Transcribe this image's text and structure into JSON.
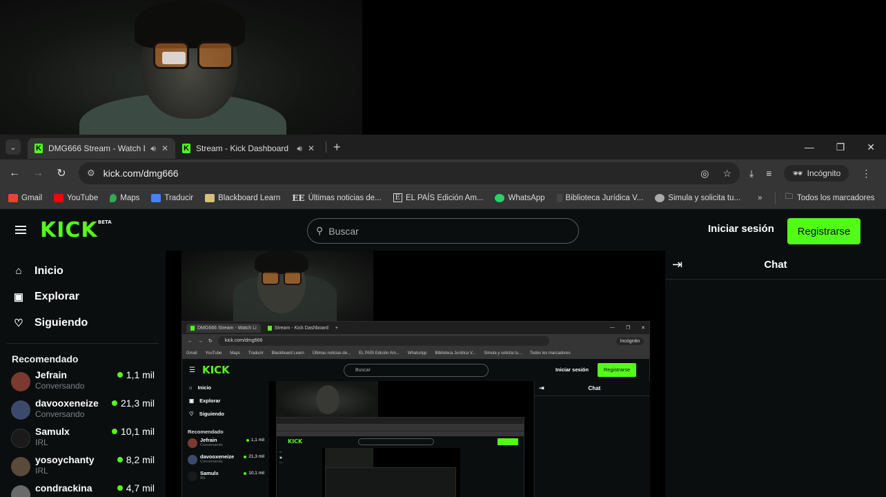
{
  "browser": {
    "tabs": [
      {
        "title": "DMG666 Stream - Watch Li",
        "active": true
      },
      {
        "title": "Stream - Kick Dashboard",
        "active": false
      }
    ],
    "url": "kick.com/dmg666",
    "incognito_label": "Incógnito",
    "bookmarks": [
      {
        "label": "Gmail",
        "color": "#ea4335"
      },
      {
        "label": "YouTube",
        "color": "#ff0000"
      },
      {
        "label": "Maps",
        "color": "#34a853"
      },
      {
        "label": "Traducir",
        "color": "#4285f4"
      },
      {
        "label": "Blackboard Learn",
        "color": "#d4c17a"
      },
      {
        "label": "Últimas noticias de...",
        "color": "#ffffff"
      },
      {
        "label": "EL PAÍS Edición Am...",
        "color": "#ffffff"
      },
      {
        "label": "WhatsApp",
        "color": "#25d366"
      },
      {
        "label": "Biblioteca Jurídica V...",
        "color": "#444444"
      },
      {
        "label": "Simula y solicita tu...",
        "color": "#cccccc"
      }
    ],
    "all_bookmarks_label": "Todos los marcadores"
  },
  "kick": {
    "logo": "KICK",
    "logo_badge": "BETA",
    "search_placeholder": "Buscar",
    "login_label": "Iniciar sesión",
    "signup_label": "Registrarse",
    "brand_color": "#53fc18",
    "nav": [
      {
        "label": "Inicio",
        "icon": "home-icon"
      },
      {
        "label": "Explorar",
        "icon": "explore-icon"
      },
      {
        "label": "Siguiendo",
        "icon": "heart-icon"
      }
    ],
    "recommended_title": "Recomendado",
    "recommended": [
      {
        "name": "Jefrain",
        "category": "Conversando",
        "viewers": "1,1 mil",
        "avatar_color": "#7a3a30"
      },
      {
        "name": "davooxeneize",
        "category": "Conversando",
        "viewers": "21,3 mil",
        "avatar_color": "#3b4a6b"
      },
      {
        "name": "Samulx",
        "category": "IRL",
        "viewers": "10,1 mil",
        "avatar_color": "#1a1a1a"
      },
      {
        "name": "yosoychanty",
        "category": "IRL",
        "viewers": "8,2 mil",
        "avatar_color": "#5a4a3a"
      },
      {
        "name": "condrackina",
        "category": "",
        "viewers": "4,7 mil",
        "avatar_color": "#6a6a6a"
      }
    ],
    "chat_title": "Chat"
  },
  "nested": {
    "tab1": "DMG666 Stream - Watch Li",
    "tab2": "Stream - Kick Dashboard",
    "url": "kick.com/dmg666",
    "incognito": "Incógnito",
    "bookmarks": [
      "Gmail",
      "YouTube",
      "Maps",
      "Traducir",
      "Blackboard Learn",
      "Últimas noticias de...",
      "EL PAÍS Edición Am...",
      "WhatsApp",
      "Biblioteca Jurídica V...",
      "Simula y solicita tu...",
      "Todos los marcadores"
    ],
    "logo": "KICK",
    "search": "Buscar",
    "login": "Iniciar sesión",
    "signup": "Registrarse",
    "nav": [
      "Inicio",
      "Explorar",
      "Siguiendo"
    ],
    "recommended_title": "Recomendado",
    "recommended": [
      {
        "name": "Jefrain",
        "category": "Conversando",
        "viewers": "1,1 mil"
      },
      {
        "name": "davooxeneize",
        "category": "Conversando",
        "viewers": "21,3 mil"
      },
      {
        "name": "Samulx",
        "category": "IRL",
        "viewers": "10,1 mil"
      }
    ],
    "chat": "Chat"
  }
}
